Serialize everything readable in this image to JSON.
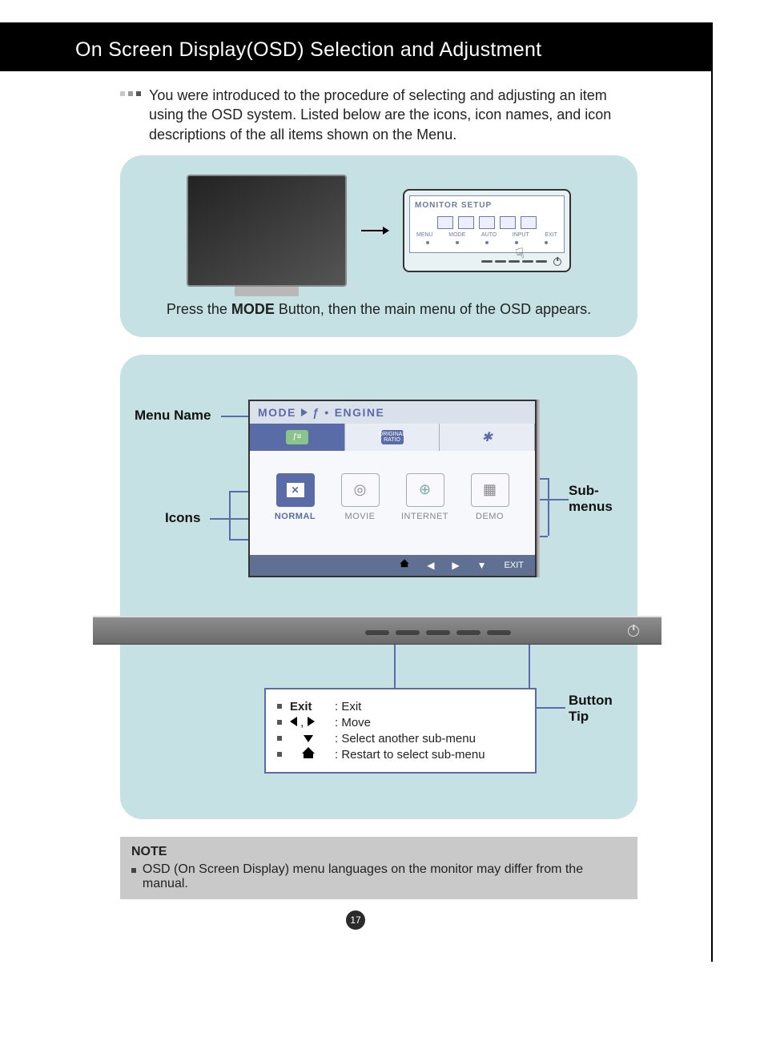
{
  "title": "On Screen Display(OSD) Selection and Adjustment",
  "intro": "You were introduced to the procedure of selecting and adjusting an item using the OSD system. Listed below are the icons, icon names, and icon descriptions of the all items shown on the Menu.",
  "panel1": {
    "osd_title": "MONITOR SETUP",
    "osd_labels": [
      "MENU",
      "MODE",
      "AUTO",
      "INPUT",
      "EXIT"
    ],
    "caption_pre": "Press the ",
    "caption_bold": "MODE",
    "caption_post": " Button, then the main menu of the OSD appears."
  },
  "panel2": {
    "labels": {
      "menu_name": "Menu Name",
      "icons": "Icons",
      "submenus": "Sub-\nmenus",
      "button_tip": "Button\nTip"
    },
    "osd": {
      "header_mode": "MODE",
      "header_engine": "ENGINE",
      "tabs": {
        "ratio": "ORIGINAL\nRATIO"
      },
      "modes": [
        {
          "label": "NORMAL",
          "active": true,
          "glyph": "✕"
        },
        {
          "label": "MOVIE",
          "active": false,
          "glyph": "◎"
        },
        {
          "label": "INTERNET",
          "active": false,
          "glyph": "⊕"
        },
        {
          "label": "DEMO",
          "active": false,
          "glyph": "▦"
        }
      ],
      "nav_exit": "EXIT"
    },
    "tips": [
      {
        "sym": "Exit",
        "symType": "text",
        "desc": ": Exit"
      },
      {
        "sym": "lr",
        "symType": "lr",
        "desc": ": Move"
      },
      {
        "sym": "down",
        "symType": "down",
        "desc": ": Select another sub-menu"
      },
      {
        "sym": "home",
        "symType": "home",
        "desc": ": Restart to select sub-menu"
      }
    ]
  },
  "note": {
    "title": "NOTE",
    "body": "OSD (On Screen Display) menu languages on the monitor may differ from the manual."
  },
  "page_number": "17"
}
